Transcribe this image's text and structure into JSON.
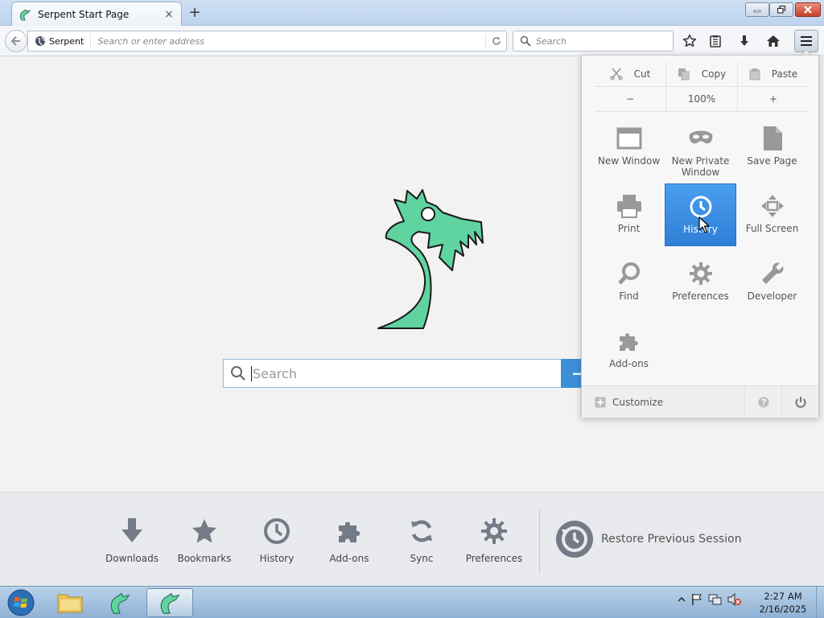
{
  "window": {
    "tab_title": "Serpent Start Page",
    "tab_close": "×",
    "new_tab": "+"
  },
  "navbar": {
    "identity_label": "Serpent",
    "url_placeholder": "Search or enter address",
    "search_placeholder": "Search"
  },
  "home": {
    "search_placeholder": "Search",
    "search_button": "→"
  },
  "launcher": {
    "items": [
      {
        "label": "Downloads",
        "icon": "download-icon"
      },
      {
        "label": "Bookmarks",
        "icon": "star-icon"
      },
      {
        "label": "History",
        "icon": "clock-icon"
      },
      {
        "label": "Add-ons",
        "icon": "puzzle-icon"
      },
      {
        "label": "Sync",
        "icon": "sync-icon"
      },
      {
        "label": "Preferences",
        "icon": "gear-icon"
      }
    ],
    "restore_label": "Restore Previous Session"
  },
  "panel": {
    "edit": {
      "cut": "Cut",
      "copy": "Copy",
      "paste": "Paste"
    },
    "zoom": {
      "minus": "−",
      "level": "100%",
      "plus": "+"
    },
    "items": [
      {
        "label": "New Window",
        "icon": "window-icon"
      },
      {
        "label": "New Private Window",
        "icon": "mask-icon"
      },
      {
        "label": "Save Page",
        "icon": "page-icon"
      },
      {
        "label": "Print",
        "icon": "printer-icon"
      },
      {
        "label": "History",
        "icon": "clock-icon"
      },
      {
        "label": "Full Screen",
        "icon": "fullscreen-icon"
      },
      {
        "label": "Find",
        "icon": "magnifier-icon"
      },
      {
        "label": "Preferences",
        "icon": "gear-icon"
      },
      {
        "label": "Developer",
        "icon": "wrench-icon"
      },
      {
        "label": "Add-ons",
        "icon": "puzzle-icon"
      }
    ],
    "customize_label": "Customize"
  },
  "taskbar": {
    "time": "2:27 AM",
    "date": "2/16/2025"
  },
  "colors": {
    "logo_green": "#5fd3a0",
    "active_item_blue": "#3a8ee6",
    "taskbar": "#a9c6e4"
  }
}
